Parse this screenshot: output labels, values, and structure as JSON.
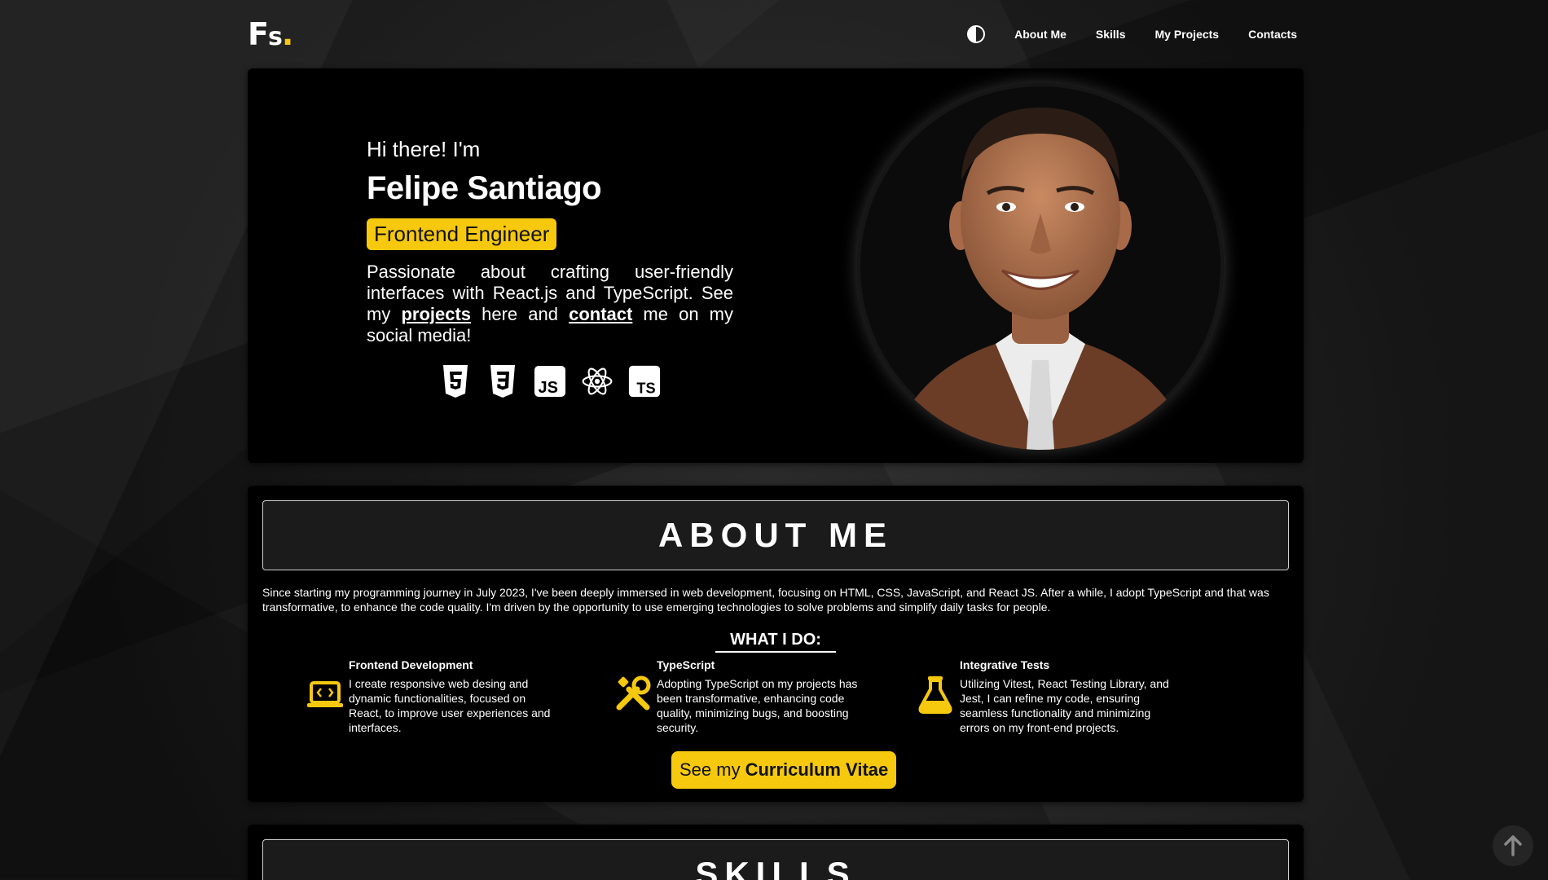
{
  "header": {
    "logo_main": "F",
    "logo_sub": "s",
    "logo_dot": ".",
    "nav": [
      {
        "label": "About Me"
      },
      {
        "label": "Skills"
      },
      {
        "label": "My Projects"
      },
      {
        "label": "Contacts"
      }
    ]
  },
  "hero": {
    "greeting": "Hi there! I'm",
    "name": "Felipe Santiago",
    "role": "Frontend Engineer",
    "bio_before": "Passionate about crafting user-friendly interfaces with React.js and TypeScript. See my ",
    "bio_link1": "projects",
    "bio_middle": " here and ",
    "bio_link2": "contact",
    "bio_after": " me on my social media!",
    "tech_icons": [
      "html5-icon",
      "css3-icon",
      "javascript-icon",
      "react-icon",
      "typescript-icon"
    ]
  },
  "about": {
    "title": "ABOUT ME",
    "text": "Since starting my programming journey in July 2023, I've been deeply immersed in web development, focusing on HTML, CSS, JavaScript, and React JS. After a while, I adopt TypeScript and that was transformative, to enhance the code quality. I'm driven by the opportunity to use emerging technologies to solve problems and simplify daily tasks for people.",
    "what_title": "WHAT I DO:",
    "services": [
      {
        "title": "Frontend Development",
        "desc": "I create responsive web desing and dynamic functionalities, focused on React, to improve user experiences and interfaces.",
        "icon": "laptop-code-icon"
      },
      {
        "title": "TypeScript",
        "desc": "Adopting TypeScript on my projects has been transformative, enhancing code quality, minimizing bugs, and boosting security.",
        "icon": "tools-icon"
      },
      {
        "title": "Integrative Tests",
        "desc": "Utilizing Vitest, React Testing Library, and Jest, I can refine my code, ensuring seamless functionality and minimizing errors on my front-end projects.",
        "icon": "flask-icon"
      }
    ],
    "cv_prefix": "See my",
    "cv_label": "Curriculum Vitae"
  },
  "skills": {
    "title": "SKILLS"
  },
  "colors": {
    "accent": "#f6c90e",
    "card": "#000000"
  }
}
